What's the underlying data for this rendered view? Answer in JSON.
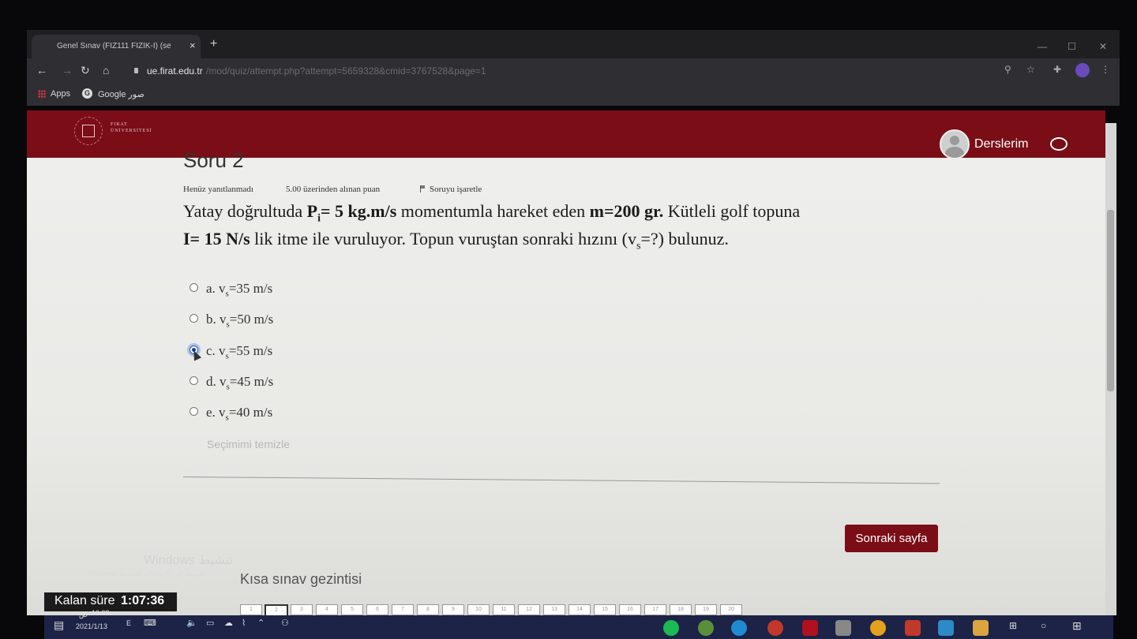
{
  "browser": {
    "tab_title": "Genel Sınav (FIZ111 FİZİK-I) (se",
    "tab_close": "×",
    "new_tab": "+",
    "url_host": "ue.firat.edu.tr",
    "url_path": "/mod/quiz/attempt.php?attempt=5659328&cmid=3767528&page=1",
    "bookmarks": [
      "Apps",
      "Google صور"
    ]
  },
  "header": {
    "university": "FIRAT ÜNİVERSİTESİ",
    "user_menu": "Derslerim"
  },
  "question": {
    "title": "Soru 2",
    "status": "Henüz yanıtlanmadı",
    "points": "5.00 üzerinden alınan puan",
    "flag": "Soruyu işaretle",
    "line1_a": "Yatay doğrultuda",
    "line1_b": "P",
    "line1_b_sub": "i",
    "line1_c": "= 5 kg.m/s",
    "line1_d": "momentumla hareket eden",
    "line1_e": "m=200 gr.",
    "line1_f": "Kütleli golf topuna",
    "line2_a": "I= 15 N/s",
    "line2_b": "lik itme ile vuruluyor. Topun vuruştan sonraki hızını (v",
    "line2_sub": "s",
    "line2_c": "=?) bulunuz."
  },
  "options": [
    {
      "prefix": "a. v",
      "sub": "s",
      "value": "=35 m/s",
      "selected": false
    },
    {
      "prefix": "b. v",
      "sub": "s",
      "value": "=50 m/s",
      "selected": false
    },
    {
      "prefix": "c. v",
      "sub": "s",
      "value": "=55 m/s",
      "selected": true
    },
    {
      "prefix": "d. v",
      "sub": "s",
      "value": "=45 m/s",
      "selected": false
    },
    {
      "prefix": "e. v",
      "sub": "s",
      "value": "=40 m/s",
      "selected": false
    }
  ],
  "clear_choice": "Seçimimi temizle",
  "next_button": "Sonraki sayfa",
  "watermark": {
    "title": "Windows تنشيط",
    "text": "Windows تنشيط إلى الإعدادات لتنشيط"
  },
  "quiz_nav_title": "Kısa sınav gezintisi",
  "timer": {
    "label": "Kalan süre",
    "value": "1:07:36"
  },
  "quiz_nav_numbers": [
    "1",
    "2",
    "3",
    "4",
    "5",
    "6",
    "7",
    "8",
    "9",
    "10",
    "11",
    "12",
    "13",
    "14",
    "15",
    "16",
    "17",
    "18",
    "19",
    "20"
  ],
  "taskbar": {
    "time": "10:22",
    "ampm": "ص",
    "date": "2021/1/13",
    "lang": "E"
  },
  "colors": {
    "brand": "#7a0d16",
    "taskbar": "#1c2346"
  }
}
